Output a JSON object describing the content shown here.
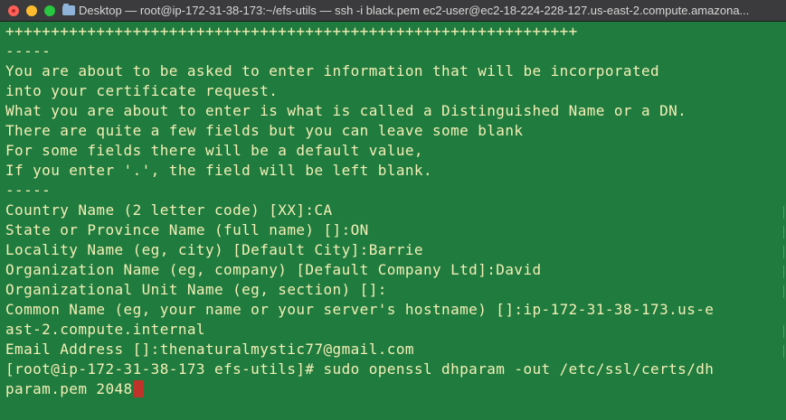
{
  "window": {
    "title": "Desktop — root@ip-172-31-38-173:~/efs-utils — ssh -i black.pem ec2-user@ec2-18-224-228-127.us-east-2.compute.amazona..."
  },
  "terminal": {
    "lines": [
      "+++++++++++++++++++++++++++++++++++++++++++++++++++++++++++++++",
      "-----",
      "You are about to be asked to enter information that will be incorporated",
      "into your certificate request.",
      "What you are about to enter is what is called a Distinguished Name or a DN.",
      "There are quite a few fields but you can leave some blank",
      "For some fields there will be a default value,",
      "If you enter '.', the field will be left blank.",
      "-----",
      "Country Name (2 letter code) [XX]:CA",
      "State or Province Name (full name) []:ON",
      "Locality Name (eg, city) [Default City]:Barrie",
      "Organization Name (eg, company) [Default Company Ltd]:David",
      "Organizational Unit Name (eg, section) []:",
      "Common Name (eg, your name or your server's hostname) []:ip-172-31-38-173.us-e",
      "ast-2.compute.internal",
      "Email Address []:thenaturalmystic77@gmail.com",
      "[root@ip-172-31-38-173 efs-utils]# sudo openssl dhparam -out /etc/ssl/certs/dh",
      "param.pem 2048"
    ]
  },
  "colors": {
    "background": "#1f7b3e",
    "text": "#f4efb6",
    "cursor": "#c0332b",
    "titlebar": "#3b3b3d"
  },
  "icons": {
    "close": "close-icon",
    "minimize": "minimize-icon",
    "zoom": "zoom-icon",
    "folder": "folder-icon"
  }
}
